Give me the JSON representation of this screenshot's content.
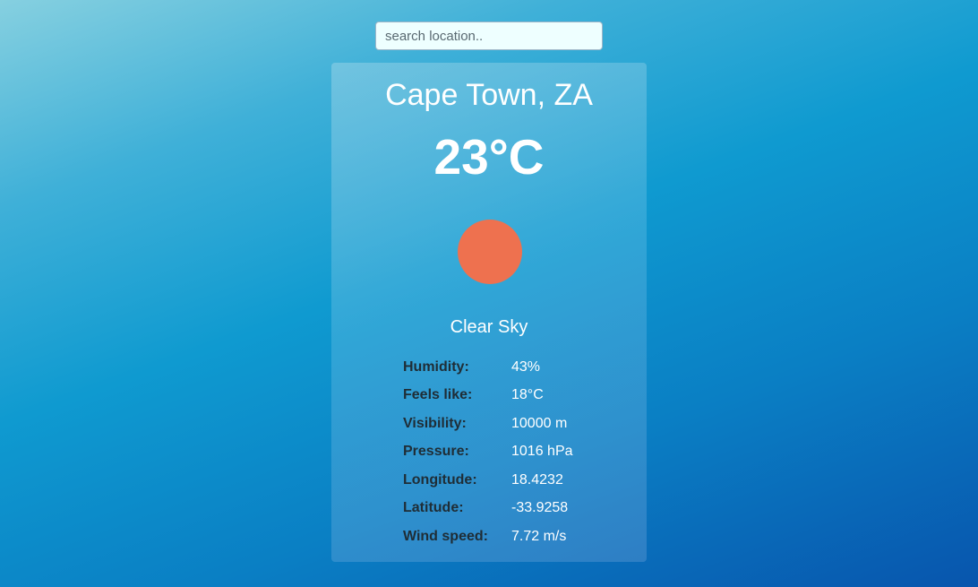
{
  "search": {
    "placeholder": "search location.."
  },
  "weather": {
    "location": "Cape Town, ZA",
    "temperature": "23°C",
    "icon": "sun-icon",
    "icon_color": "#ee714f",
    "condition": "Clear Sky",
    "details": [
      {
        "label": "Humidity:",
        "value": "43%"
      },
      {
        "label": "Feels like:",
        "value": "18°C"
      },
      {
        "label": "Visibility:",
        "value": "10000 m"
      },
      {
        "label": "Pressure:",
        "value": "1016 hPa"
      },
      {
        "label": "Longitude:",
        "value": "18.4232"
      },
      {
        "label": "Latitude:",
        "value": "-33.9258"
      },
      {
        "label": "Wind speed:",
        "value": "7.72 m/s"
      }
    ]
  }
}
